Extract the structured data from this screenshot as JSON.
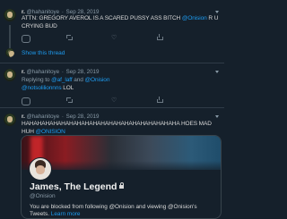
{
  "tweets": [
    {
      "name": "r.",
      "handle": "@hahanitoye",
      "date": "Sep 28, 2019",
      "text_pre": "ATTN: GREGORY AVEROL IS A SCARED PUSSY ASS BITCH ",
      "mention": "@Onision",
      "text_post": " R U CRYING BUD",
      "show_thread": "Show this thread"
    },
    {
      "name": "r.",
      "handle": "@hahanitoye",
      "date": "Sep 28, 2019",
      "reply_prefix": "Replying to ",
      "reply_to_1": "@af_laff",
      "reply_and": " and ",
      "reply_to_2": "@Onision",
      "mention": "@notsolilionnns",
      "text_post": " LOL"
    },
    {
      "name": "r.",
      "handle": "@hahanitoye",
      "date": "Sep 28, 2019",
      "text_pre": "HAHAHAHAHAHAHAHAHAHAHAHAHAHAHAHAHAHAHAHA HOES MAD HUH ",
      "mention": "@ONISION",
      "card": {
        "name": "James, The Legend",
        "handle": "@Onision",
        "message_pre": "You are blocked from following @Onision and viewing @Onision's Tweets. ",
        "link": "Learn more"
      }
    }
  ],
  "header_separator": "·",
  "icons": {
    "avatar": "profile-avatar",
    "caret": "chevron-down-icon",
    "reply": "reply-icon",
    "retweet": "retweet-icon",
    "like": "heart-icon",
    "share": "share-icon",
    "lock": "lock-icon"
  },
  "colors": {
    "background": "#15202b",
    "link": "#1d9bf0",
    "secondary_text": "#8899a6"
  }
}
